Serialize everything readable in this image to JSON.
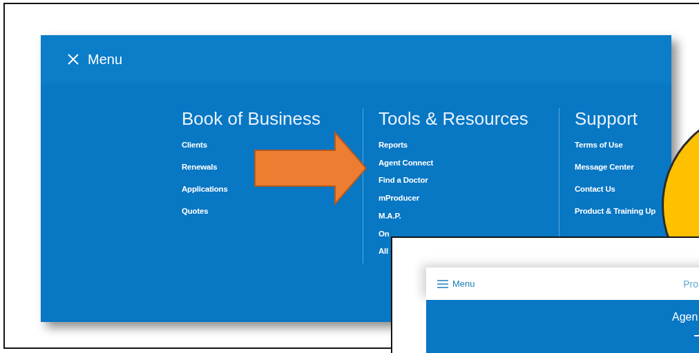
{
  "menu_screen": {
    "title": "Menu",
    "columns": [
      {
        "heading": "Book of Business",
        "items": [
          "Clients",
          "Renewals",
          "Applications",
          "Quotes"
        ]
      },
      {
        "heading": "Tools & Resources",
        "items": [
          "Reports",
          "Agent Connect",
          "Find a Doctor",
          "mProducer",
          "M.A.P.",
          "On",
          "All"
        ]
      },
      {
        "heading": "Support",
        "items": [
          "Terms of Use",
          "Message Center",
          "Contact Us",
          "Product & Training Up"
        ]
      }
    ]
  },
  "inset_screen": {
    "menu_label": "Menu",
    "link": "Pro",
    "banner_title": "Agen"
  }
}
